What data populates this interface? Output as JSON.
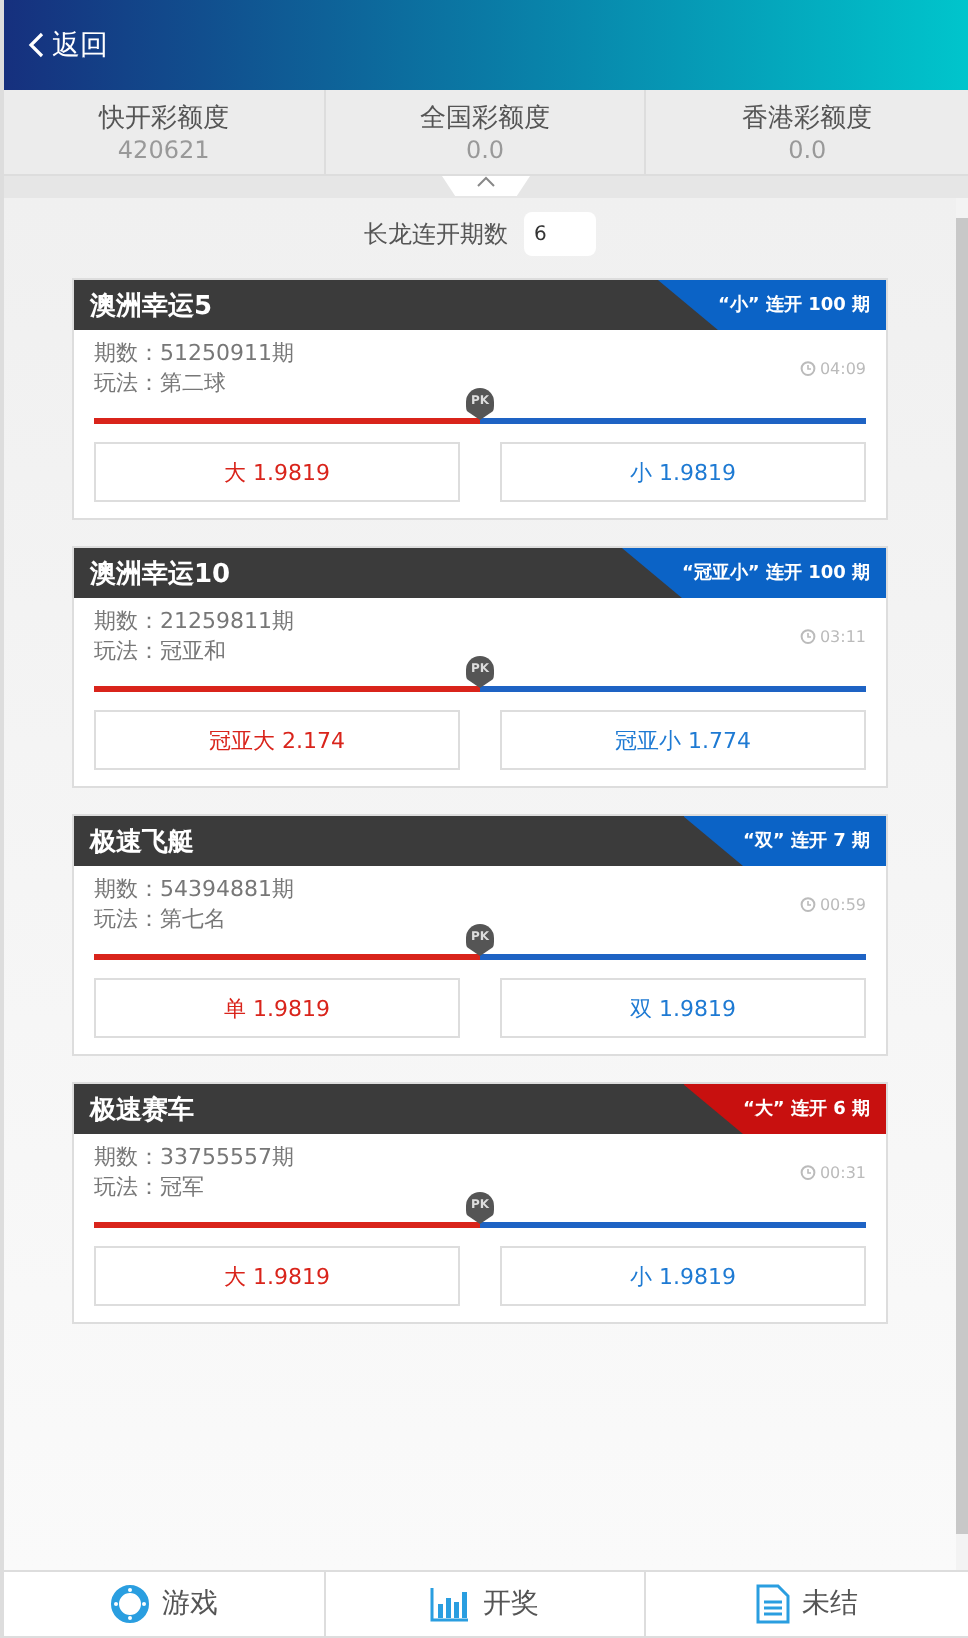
{
  "header": {
    "back": "返回"
  },
  "stats": [
    {
      "label": "快开彩额度",
      "value": "420621"
    },
    {
      "label": "全国彩额度",
      "value": "0.0"
    },
    {
      "label": "香港彩额度",
      "value": "0.0"
    }
  ],
  "filter": {
    "label": "长龙连开期数",
    "value": "6"
  },
  "cards": [
    {
      "title": "澳洲幸运5",
      "badge": "“小” 连开 100 期",
      "color": "#0b63c6",
      "period": "期数：51250911期",
      "play": "玩法：第二球",
      "time": "04:09",
      "marker": "PK",
      "level": 0.5,
      "options": [
        "大 1.9819",
        "小 1.9819"
      ]
    },
    {
      "title": "澳洲幸运10",
      "badge": "“冠亚小” 连开 100 期",
      "color": "#0b63c6",
      "period": "期数：21259811期",
      "play": "玩法：冠亚和",
      "time": "03:11",
      "marker": "PK",
      "level": 0.5,
      "options": [
        "冠亚大 2.174",
        "冠亚小 1.774"
      ]
    },
    {
      "title": "极速飞艇",
      "badge": "“双” 连开 7 期",
      "color": "#0b63c6",
      "period": "期数：54394881期",
      "play": "玩法：第七名",
      "time": "00:59",
      "marker": "PK",
      "level": 0.5,
      "options": [
        "单 1.9819",
        "双 1.9819"
      ]
    },
    {
      "title": "极速赛车",
      "badge": "“大” 连开 6 期",
      "color": "#c8100f",
      "period": "期数：33755557期",
      "play": "玩法：冠军",
      "time": "00:31",
      "marker": "PK",
      "level": 0.5,
      "options": [
        "大 1.9819",
        "小 1.9819"
      ]
    }
  ],
  "tabbar": [
    {
      "kind": "games",
      "label": "游戏"
    },
    {
      "kind": "draws",
      "label": "开奖"
    },
    {
      "kind": "pending",
      "label": "未结"
    }
  ]
}
